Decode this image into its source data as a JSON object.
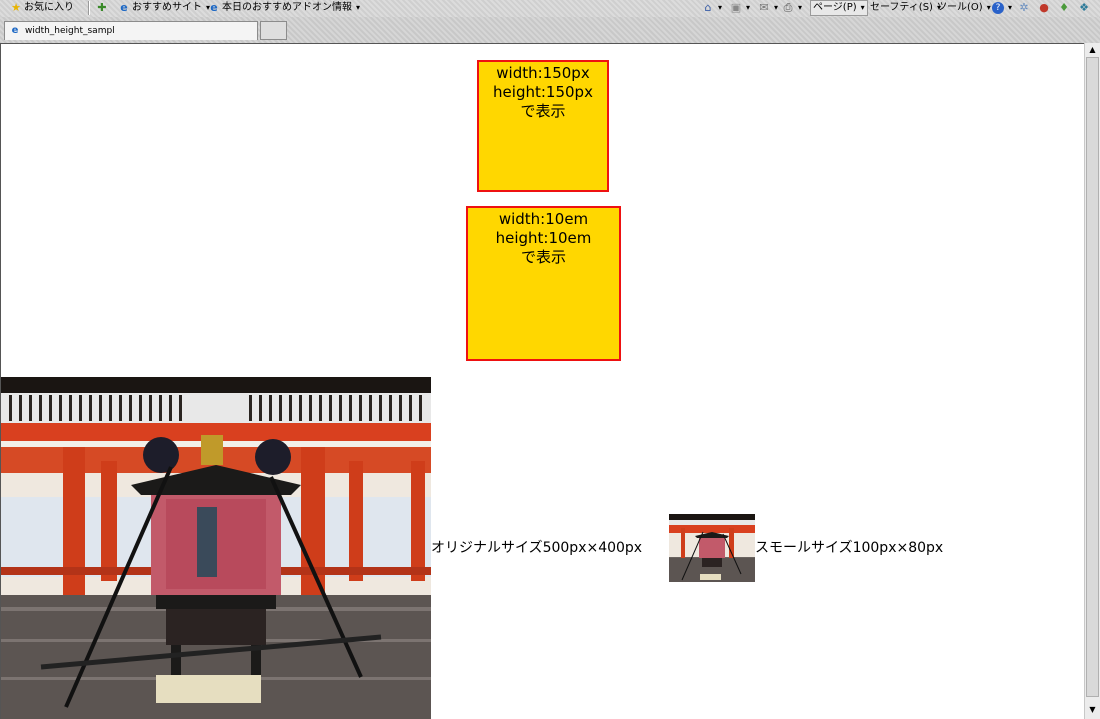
{
  "toolbar": {
    "favorites": "お気に入り",
    "suggested_sites": "おすすめサイト",
    "addons": "本日のおすすめアドオン情報",
    "page": "ページ(P)",
    "safety": "セーフティ(S)",
    "tools": "ツール(O)"
  },
  "tab": {
    "title": "width_height_sampl"
  },
  "boxes": [
    {
      "line1": "width:150px",
      "line2": "height:150px",
      "line3": "で表示"
    },
    {
      "line1": "width:10em",
      "line2": "height:10em",
      "line3": "で表示"
    }
  ],
  "captions": {
    "original": "オリジナルサイズ500px×400px",
    "small": "スモールサイズ100px×80px"
  },
  "colors": {
    "box_fill": "#ffd700",
    "box_border": "#ee1111",
    "accent_red": "#d9401f"
  },
  "icons": [
    "star-icon",
    "add-favorites-icon",
    "ie-icon",
    "home-icon",
    "rss-icon",
    "mail-icon",
    "print-icon",
    "help-icon"
  ]
}
